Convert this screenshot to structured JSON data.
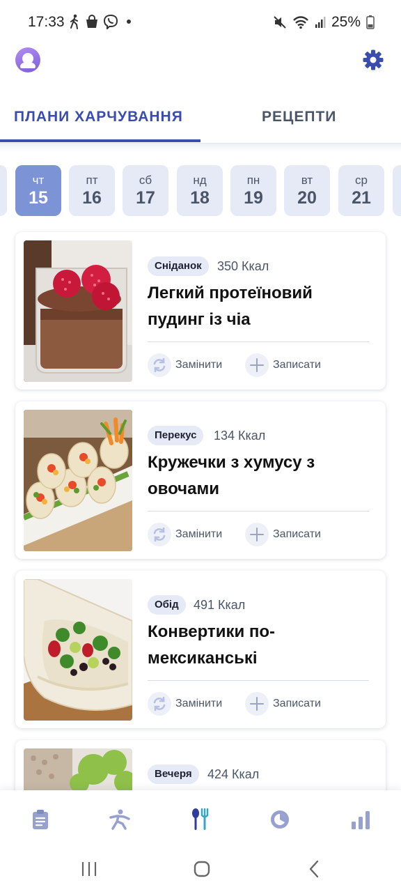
{
  "status_bar": {
    "time": "17:33",
    "battery": "25%",
    "left_icons": [
      "walk-icon",
      "bag-icon",
      "viber-icon",
      "dot-icon"
    ],
    "right_icons": [
      "mute-icon",
      "wifi-icon",
      "signal-icon",
      "battery-icon"
    ]
  },
  "header": {
    "avatar_icon": "avatar-icon",
    "settings_icon": "gear-icon",
    "accent_color": "#3a4cad"
  },
  "tabs": [
    {
      "label": "ПЛАНИ ХАРЧУВАННЯ",
      "active": true
    },
    {
      "label": "РЕЦЕПТИ",
      "active": false
    }
  ],
  "dates": [
    {
      "dow": "",
      "day": "",
      "selected": false
    },
    {
      "dow": "чт",
      "day": "15",
      "selected": true
    },
    {
      "dow": "пт",
      "day": "16",
      "selected": false
    },
    {
      "dow": "сб",
      "day": "17",
      "selected": false
    },
    {
      "dow": "нд",
      "day": "18",
      "selected": false
    },
    {
      "dow": "пн",
      "day": "19",
      "selected": false
    },
    {
      "dow": "вт",
      "day": "20",
      "selected": false
    },
    {
      "dow": "ср",
      "day": "21",
      "selected": false
    },
    {
      "dow": "",
      "day": "",
      "selected": false
    }
  ],
  "meals": [
    {
      "type": "Сніданок",
      "kcal": "350 Ккал",
      "title": "Легкий протеїновий пудинг із чіа",
      "replace_label": "Замінити",
      "log_label": "Записати",
      "photo": "chia-pudding-photo"
    },
    {
      "type": "Перекус",
      "kcal": "134 Ккал",
      "title": "Кружечки з хумусу з овочами",
      "replace_label": "Замінити",
      "log_label": "Записати",
      "photo": "hummus-rolls-photo"
    },
    {
      "type": "Обід",
      "kcal": "491 Ккал",
      "title": "Конвертики по-мексиканські",
      "replace_label": "Замінити",
      "log_label": "Записати",
      "photo": "mexican-wrap-photo"
    },
    {
      "type": "Вечеря",
      "kcal": "424 Ккал",
      "title": "",
      "replace_label": "",
      "log_label": "",
      "photo": "dinner-salad-photo"
    }
  ],
  "bottom_nav": [
    {
      "icon": "clipboard-icon",
      "active": false
    },
    {
      "icon": "activity-icon",
      "active": false
    },
    {
      "icon": "cutlery-icon",
      "active": true
    },
    {
      "icon": "fasting-icon",
      "active": false
    },
    {
      "icon": "stats-icon",
      "active": false
    }
  ],
  "android_nav": [
    "recents-icon",
    "home-icon",
    "back-icon"
  ]
}
